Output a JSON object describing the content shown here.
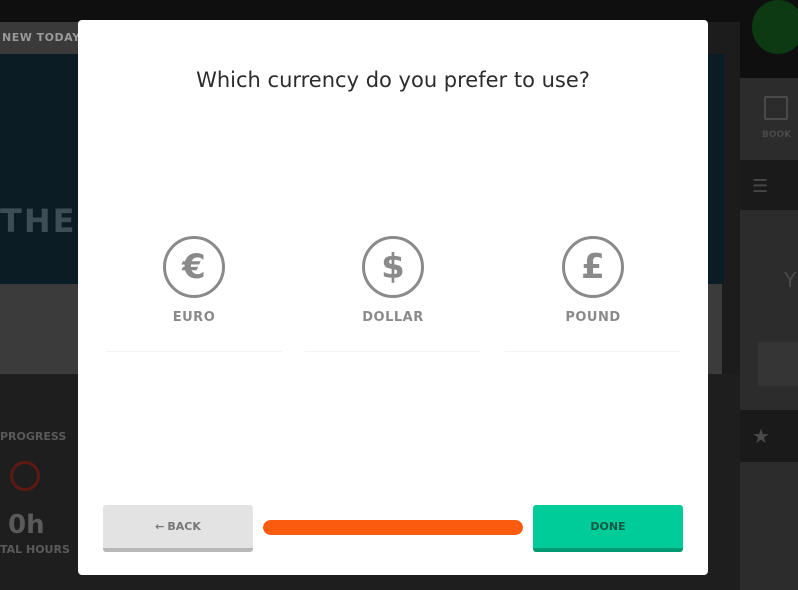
{
  "background": {
    "tag": "NEW TODAY",
    "hero_text": "THE N",
    "progress_label": "PROGRESS",
    "hours": "0h",
    "total_hours_label": "TAL HOURS",
    "book_label": "BOOK",
    "side_text": "Y"
  },
  "modal": {
    "title": "Which currency do you prefer to use?",
    "options": [
      {
        "symbol": "€",
        "label": "EURO",
        "icon": "euro-icon"
      },
      {
        "symbol": "$",
        "label": "DOLLAR",
        "icon": "dollar-icon"
      },
      {
        "symbol": "£",
        "label": "POUND",
        "icon": "pound-icon"
      }
    ],
    "back_label": "BACK",
    "back_arrow": "🡐",
    "done_label": "DONE",
    "progress": 1.0
  },
  "colors": {
    "accent_progress": "#fa5b0f",
    "done_button": "#00cc9a",
    "icon_gray": "#8a8a8a"
  }
}
